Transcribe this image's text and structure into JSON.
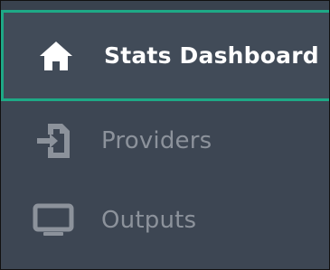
{
  "sidebar": {
    "items": [
      {
        "label": "Stats Dashboard",
        "icon": "home-icon",
        "active": true
      },
      {
        "label": "Providers",
        "icon": "import-file-icon",
        "active": false
      },
      {
        "label": "Outputs",
        "icon": "monitor-icon",
        "active": false
      }
    ]
  },
  "colors": {
    "background": "#3d4653",
    "active_border": "#1ea986",
    "active_text": "#ffffff",
    "inactive_text": "#8c929b"
  }
}
